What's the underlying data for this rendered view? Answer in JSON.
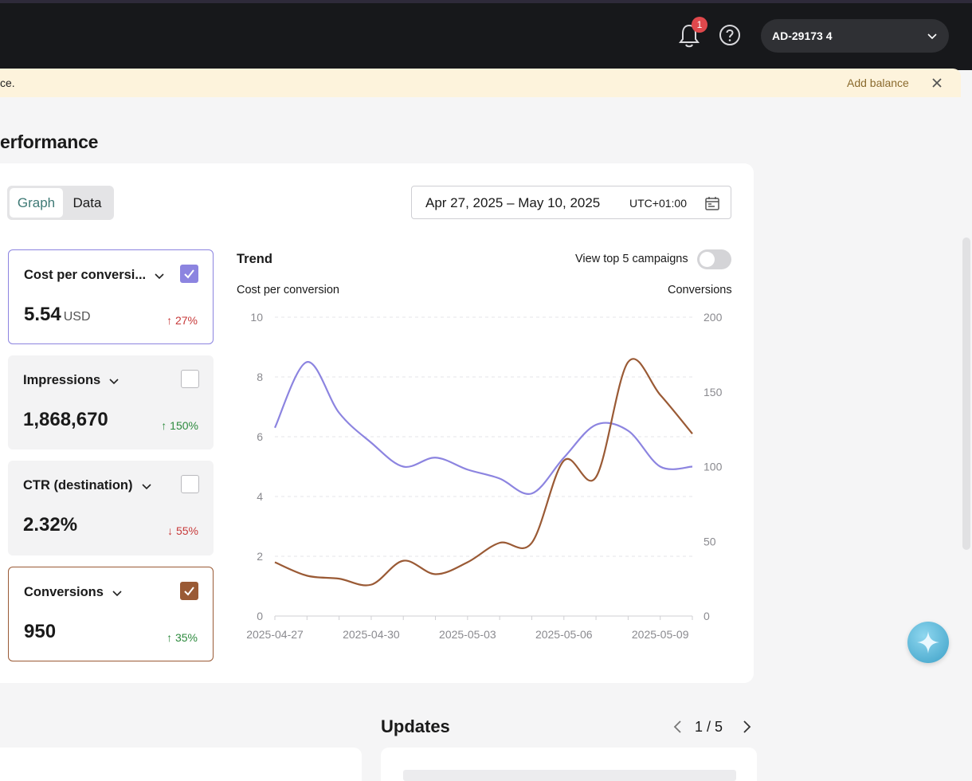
{
  "topbar": {
    "notifications_count": "1",
    "account_name": "AD-29173 4"
  },
  "banner": {
    "text": "ce.",
    "action": "Add balance"
  },
  "page": {
    "title": "erformance"
  },
  "view_toggle": {
    "graph_label": "Graph",
    "data_label": "Data",
    "selected": "Graph"
  },
  "date_range": {
    "text": "Apr 27, 2025 – May 10, 2025",
    "timezone": "UTC+01:00"
  },
  "metrics": [
    {
      "title": "Cost per conversi...",
      "value": "5.54",
      "unit": "USD",
      "delta": "↑ 27%",
      "checked": true,
      "color": "#8c84e0"
    },
    {
      "title": "Impressions",
      "value": "1,868,670",
      "unit": "",
      "delta": "↑ 150%",
      "checked": false,
      "color": ""
    },
    {
      "title": "CTR (destination)",
      "value": "2.32%",
      "unit": "",
      "delta": "↓ 55%",
      "checked": false,
      "color": ""
    },
    {
      "title": "Conversions",
      "value": "950",
      "unit": "",
      "delta": "↑ 35%",
      "checked": true,
      "color": "#9a5a35"
    }
  ],
  "trend": {
    "title": "Trend",
    "toggle_label": "View top 5 campaigns",
    "toggle_on": false
  },
  "chart_data": {
    "type": "line",
    "title": "",
    "x": [
      "2025-04-27",
      "2025-04-28",
      "2025-04-29",
      "2025-04-30",
      "2025-05-01",
      "2025-05-02",
      "2025-05-03",
      "2025-05-04",
      "2025-05-05",
      "2025-05-06",
      "2025-05-07",
      "2025-05-08",
      "2025-05-09",
      "2025-05-10"
    ],
    "x_tick_labels": [
      "2025-04-27",
      "2025-04-30",
      "2025-05-03",
      "2025-05-06",
      "2025-05-09"
    ],
    "ylabel_left": "Cost per conversion",
    "ylabel_right": "Conversions",
    "ylim_left": [
      0,
      10
    ],
    "ylim_right": [
      0,
      200
    ],
    "yticks_left": [
      0,
      2,
      4,
      6,
      8,
      10
    ],
    "yticks_right": [
      0,
      50,
      100,
      150,
      200
    ],
    "grid": true,
    "series": [
      {
        "name": "Cost per conversion",
        "axis": "left",
        "color": "#8c84e0",
        "values": [
          6.3,
          8.5,
          6.8,
          5.8,
          5.0,
          5.3,
          4.9,
          4.6,
          4.1,
          5.3,
          6.4,
          6.2,
          5.0,
          5.0
        ]
      },
      {
        "name": "Conversions",
        "axis": "right",
        "color": "#9a5a35",
        "values": [
          36,
          27,
          25,
          21,
          37,
          28,
          36,
          49,
          49,
          104,
          93,
          170,
          148,
          122
        ]
      }
    ]
  },
  "updates": {
    "title": "Updates",
    "pager": "1 / 5"
  }
}
